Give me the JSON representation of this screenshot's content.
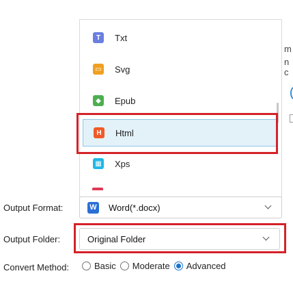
{
  "format_list": {
    "items": [
      {
        "label": "Txt",
        "icon": "txt-icon",
        "color": "#6b7fe0"
      },
      {
        "label": "Svg",
        "icon": "svg-icon",
        "color": "#f0a020"
      },
      {
        "label": "Epub",
        "icon": "epub-icon",
        "color": "#4caf50"
      },
      {
        "label": "Html",
        "icon": "html-icon",
        "color": "#f05a28"
      },
      {
        "label": "Xps",
        "icon": "xps-icon",
        "color": "#1fb8e6"
      }
    ],
    "selected_index": 3
  },
  "output_format": {
    "label": "Output Format:",
    "value": "Word(*.docx)",
    "icon": "word-icon",
    "icon_color": "#2b6fd6"
  },
  "output_folder": {
    "label": "Output Folder:",
    "value": "Original Folder"
  },
  "convert_method": {
    "label": "Convert Method:",
    "options": [
      "Basic",
      "Moderate",
      "Advanced"
    ],
    "selected": "Advanced"
  },
  "background_fragments": [
    "m",
    "n c"
  ],
  "colors": {
    "highlight": "#d42228",
    "selection_bg": "#e3f1f9",
    "radio_accent": "#1a73c8"
  }
}
